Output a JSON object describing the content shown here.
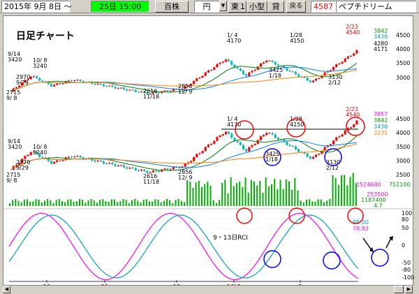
{
  "toolbar": {
    "date": "2015年  9月  8日 ～",
    "period": "25日 15:00",
    "unit": "百株",
    "currency": "円",
    "market": "東１",
    "size": "小型",
    "lending": "貸",
    "back_label": "戻る",
    "code": "4587",
    "name": "ペプチドリーム"
  },
  "chart_title": "日足チャート",
  "annotation_rci": "9・13日RCI",
  "upper_chart": {
    "right_labels": [
      "3842",
      "3436",
      "4280",
      "4171"
    ],
    "scale": [
      "4500",
      "4000",
      "3500",
      "3000"
    ],
    "peak_top_date": "2/23",
    "peak_top_price": "4540",
    "labels": [
      {
        "t": "9/14",
        "v": "3420"
      },
      {
        "t": "10/ 8",
        "v": "3240"
      },
      {
        "t": "2970",
        "v": "9/29"
      },
      {
        "t": "2715",
        "v": "9/ 8"
      },
      {
        "t": "2616",
        "v": "11/18"
      },
      {
        "t": "2856",
        "v": "12/ 9"
      },
      {
        "t": "1/ 4",
        "v": "4170"
      },
      {
        "t": "1/28",
        "v": "4150"
      },
      {
        "t": "3425",
        "v": "1/18"
      },
      {
        "t": "3130",
        "v": "2/12"
      }
    ]
  },
  "lower_chart": {
    "right_labels": [
      "3857",
      "3842",
      "3436",
      "3231"
    ],
    "scale": [
      "4500",
      "4000",
      "3500",
      "3000",
      "2500"
    ],
    "peak_top_date": "2/23",
    "peak_top_price": "4540",
    "labels": [
      {
        "t": "9/14",
        "v": "3420"
      },
      {
        "t": "10/ 8",
        "v": "3240"
      },
      {
        "t": "2970",
        "v": "9/29"
      },
      {
        "t": "2715",
        "v": "9/ 8"
      },
      {
        "t": "2616",
        "v": "11/18"
      },
      {
        "t": "2856",
        "v": "12/ 9"
      },
      {
        "t": "1/ 4",
        "v": "4170"
      },
      {
        "t": "1/28",
        "v": "4150"
      },
      {
        "t": "3425",
        "v": "1/18"
      },
      {
        "t": "3130",
        "v": "2/12"
      }
    ]
  },
  "volume_chart": {
    "right_labels": [
      "2524600",
      "751100",
      "253500",
      "1187400",
      "4.7"
    ]
  },
  "rci_chart": {
    "scale": [
      "100",
      "80",
      "50",
      "0",
      "-50",
      "-80",
      "-100"
    ],
    "values": [
      "95.00",
      "78.92"
    ],
    "month_labels": [
      "10",
      "11",
      "12",
      "16/ 1",
      "2"
    ]
  },
  "colors": {
    "up": "#ff0000",
    "down": "#00c0c0",
    "ma_short": "#008000",
    "ma_mid": "#0080ff",
    "ma_long": "#ff8000",
    "rci_fast": "#ff00ff",
    "rci_slow": "#00a0c0",
    "circle_red": "#ff0000",
    "circle_blue": "#0000ff",
    "volume": "#00b000"
  }
}
